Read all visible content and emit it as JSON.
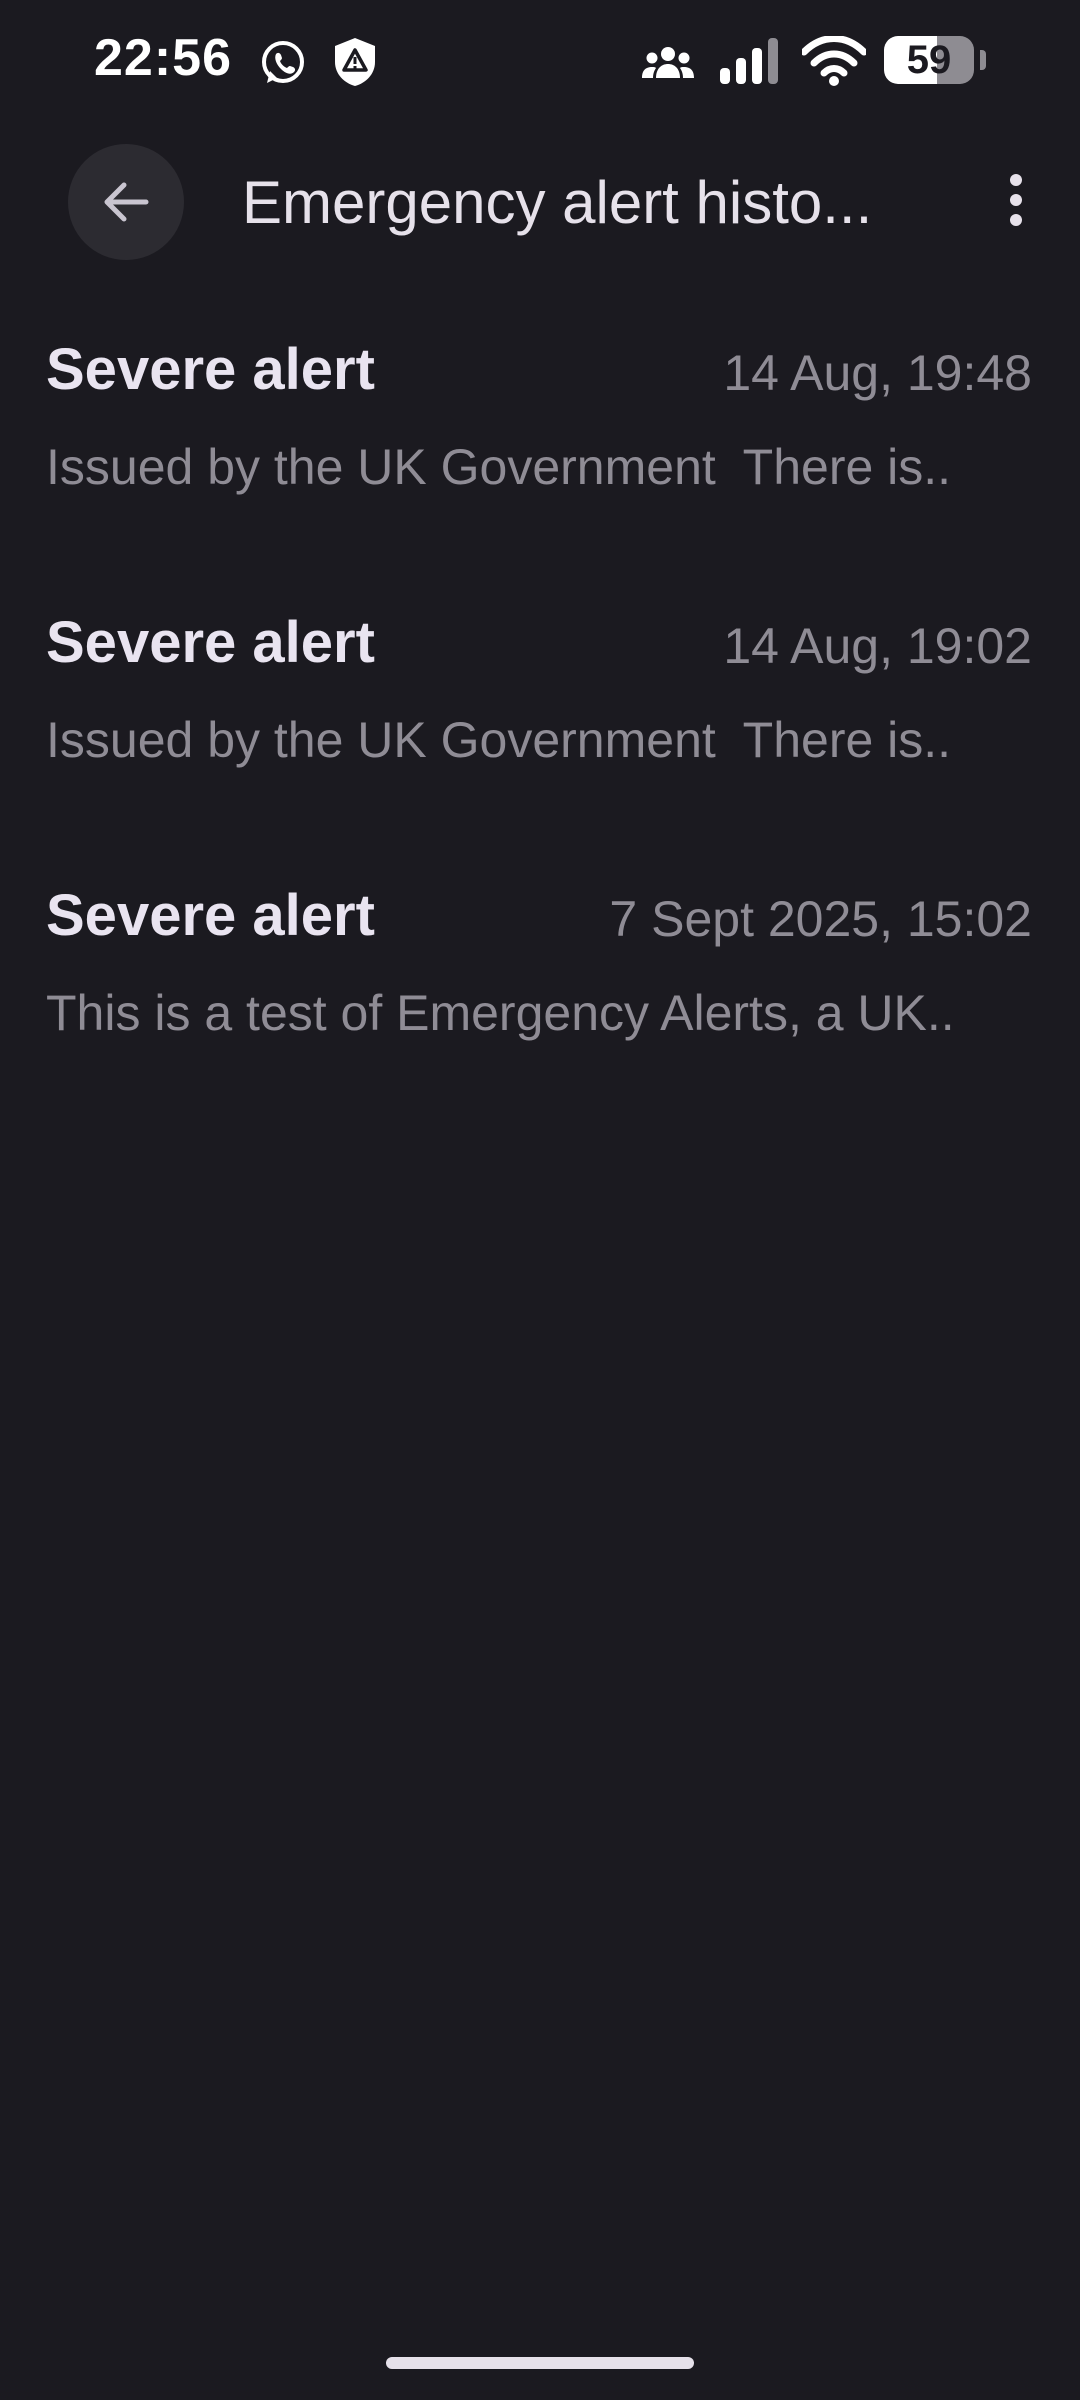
{
  "status_bar": {
    "time": "22:56",
    "battery_level": "59",
    "battery_fraction": 0.59,
    "icons": [
      "whatsapp-icon",
      "alert-shield-icon",
      "people-icon",
      "signal-icon",
      "wifi-icon",
      "battery-icon"
    ]
  },
  "app_bar": {
    "title": "Emergency alert histo...",
    "back_icon": "arrow-back-icon",
    "menu_icon": "more-vert-icon"
  },
  "alerts": [
    {
      "title": "Severe alert",
      "time": "14 Aug, 19:48",
      "preview": "Issued by the UK Government  There is.."
    },
    {
      "title": "Severe alert",
      "time": "14 Aug, 19:02",
      "preview": "Issued by the UK Government  There is.."
    },
    {
      "title": "Severe alert",
      "time": "7 Sept 2025, 15:02",
      "preview": "This is a test of Emergency Alerts, a UK.."
    }
  ],
  "colors": {
    "background": "#1b1a20",
    "primary_text": "#e6e1ea",
    "secondary_text": "#8f8c95",
    "back_button_bg": "#2c2b31"
  }
}
